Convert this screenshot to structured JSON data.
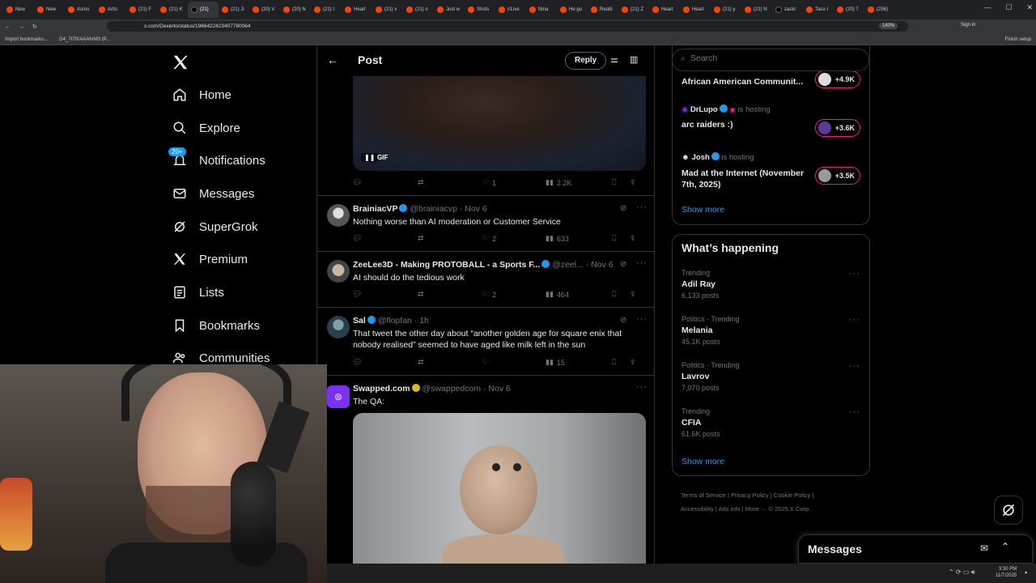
{
  "browser": {
    "tabs": [
      "New",
      "New",
      "Asmo",
      "Artis",
      "(21) F",
      "(21) K",
      "(21)",
      "(21) Ji",
      "(20) V",
      "(20) N",
      "(21) I",
      "Heart",
      "(21) v",
      "(21) n",
      "Just w",
      "Shots",
      "r/Live",
      "Nina",
      "He gu",
      "Reddi",
      "(21) Z",
      "Heart",
      "Heart",
      "(21) y",
      "(21) N",
      "zackr",
      "Taco I",
      "(20) T",
      "(256)"
    ],
    "url": "x.com/Dexerto/status/1986422423407780064",
    "zoom": "140%",
    "signin": "Sign in",
    "bookmarks": [
      "Import bookmarks...",
      "G4_7t7fXAAAhrM3 (P..."
    ],
    "finish_setup": "Finish setup"
  },
  "nav": {
    "items": [
      {
        "label": "Home",
        "icon": "home-icon"
      },
      {
        "label": "Explore",
        "icon": "search-icon"
      },
      {
        "label": "Notifications",
        "icon": "bell-icon",
        "badge": "20+"
      },
      {
        "label": "Messages",
        "icon": "mail-icon"
      },
      {
        "label": "SuperGrok",
        "icon": "grok-icon"
      },
      {
        "label": "Premium",
        "icon": "x-logo-icon"
      },
      {
        "label": "Lists",
        "icon": "list-icon"
      },
      {
        "label": "Bookmarks",
        "icon": "bookmark-icon"
      },
      {
        "label": "Communities",
        "icon": "people-icon"
      }
    ]
  },
  "header": {
    "title": "Post",
    "reply": "Reply"
  },
  "gif_tweet": {
    "gif_label": "GIF",
    "likes": "1",
    "views": "2.2K"
  },
  "tweets": [
    {
      "name": "BrainiacVP",
      "handle": "@brainiacvp",
      "time": "· Nov 6",
      "text": "Nothing worse than AI moderation or Customer Service",
      "likes": "2",
      "views": "633"
    },
    {
      "name": "ZeeLee3D - Making PROTOBALL - a Sports F...",
      "handle": "@zeel...",
      "time": "· Nov 6",
      "text": "AI should do the tedious work",
      "likes": "2",
      "views": "464"
    },
    {
      "name": "Sal",
      "handle": "@flopfan",
      "time": "· 1h",
      "text": "That tweet the other day about “another golden age for square enix that nobody realised” seemed to have aged like milk left in the sun",
      "likes": "",
      "views": "15"
    },
    {
      "name": "Swapped.com",
      "handle": "@swappedcom",
      "time": "· Nov 6",
      "text": "The QA:",
      "likes": "",
      "views": ""
    }
  ],
  "search": {
    "placeholder": "Search"
  },
  "spaces": {
    "top_title": "African American Communit...",
    "top_count": "+4.9K",
    "items": [
      {
        "host": "DrLupo",
        "hosting": "is hosting",
        "title": "arc raiders :)",
        "count": "+3.6K"
      },
      {
        "host": "Josh",
        "hosting": "is hosting",
        "title": "Mad at the Internet (November 7th, 2025)",
        "count": "+3.5K"
      }
    ],
    "show_more": "Show more"
  },
  "happening": {
    "title": "What’s happening",
    "trends": [
      {
        "context": "Trending",
        "name": "Adil Ray",
        "posts": "6,133 posts"
      },
      {
        "context": "Politics · Trending",
        "name": "Melania",
        "posts": "45.1K posts"
      },
      {
        "context": "Politics · Trending",
        "name": "Lavrov",
        "posts": "7,070 posts"
      },
      {
        "context": "Trending",
        "name": "CFIA",
        "posts": "61.6K posts"
      }
    ],
    "show_more": "Show more"
  },
  "footer": {
    "links": [
      "Terms of Service",
      "Privacy Policy",
      "Cookie Policy",
      "Accessibility",
      "Ads info",
      "More ···",
      "© 2025 X Corp."
    ]
  },
  "messages_dock": {
    "title": "Messages"
  },
  "clock": {
    "time": "3:30 PM",
    "date": "11/7/2025"
  }
}
